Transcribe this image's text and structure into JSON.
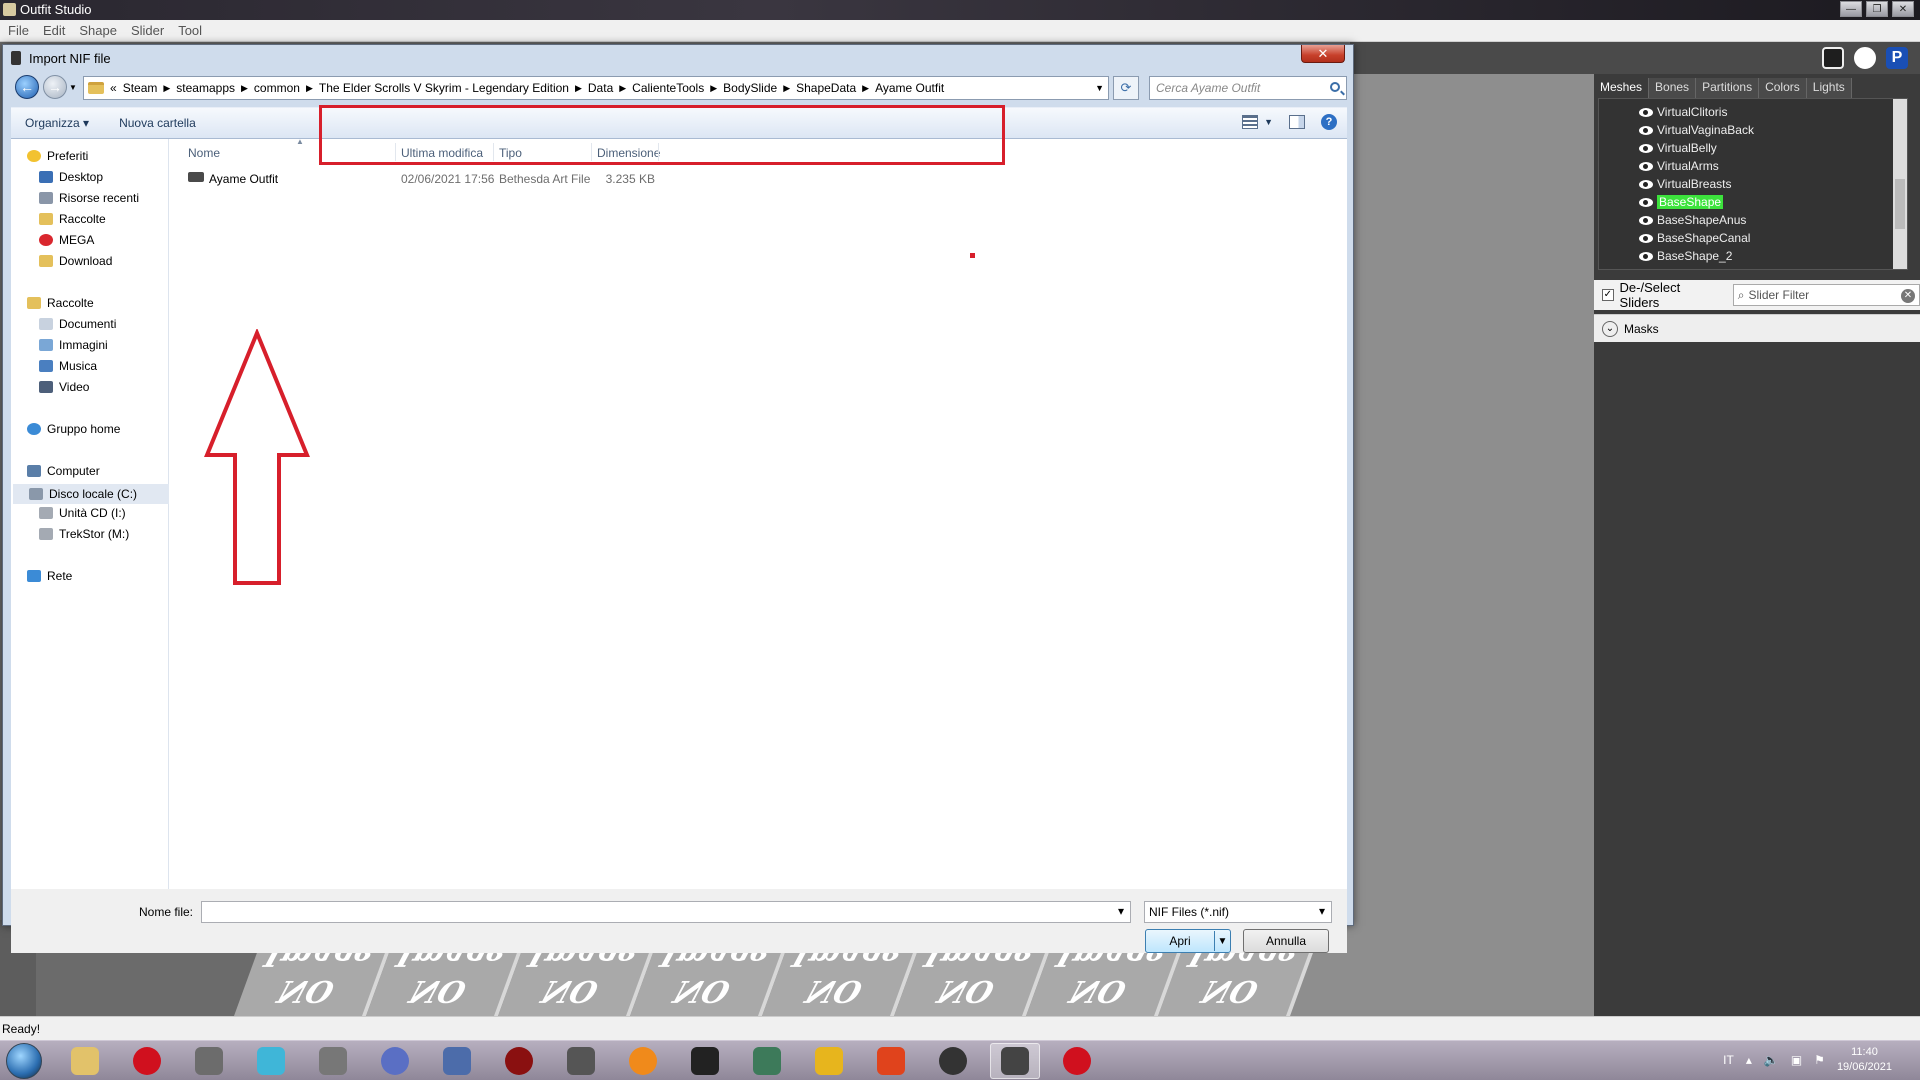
{
  "app": {
    "title": "Outfit Studio",
    "menu": [
      "File",
      "Edit",
      "Shape",
      "Slider",
      "Tool"
    ],
    "status": "Ready!"
  },
  "right_panel": {
    "tabs": [
      "Meshes",
      "Bones",
      "Partitions",
      "Colors",
      "Lights"
    ],
    "meshes": [
      "VirtualClitoris",
      "VirtualVaginaBack",
      "VirtualBelly",
      "VirtualArms",
      "VirtualBreasts",
      "BaseShape",
      "BaseShapeAnus",
      "BaseShapeCanal",
      "BaseShape_2"
    ],
    "selected_mesh": "BaseShape",
    "deselect_label": "De-/Select Sliders",
    "slider_filter_placeholder": "Slider Filter",
    "masks_label": "Masks"
  },
  "no_image": {
    "line1": "Image",
    "line2": "NO"
  },
  "dialog": {
    "title": "Import NIF file",
    "close_label": "✕",
    "breadcrumb_prefix": "«",
    "breadcrumbs": [
      "Steam",
      "steamapps",
      "common",
      "The Elder Scrolls V Skyrim - Legendary Edition",
      "Data",
      "CalienteTools",
      "BodySlide",
      "ShapeData",
      "Ayame Outfit"
    ],
    "search_placeholder": "Cerca Ayame Outfit",
    "organize_label": "Organizza ▾",
    "new_folder_label": "Nuova cartella",
    "nav_pane": [
      {
        "label": "Preferiti",
        "group": true
      },
      {
        "label": "Desktop"
      },
      {
        "label": "Risorse recenti"
      },
      {
        "label": "Raccolte"
      },
      {
        "label": "MEGA"
      },
      {
        "label": "Download"
      },
      {
        "label": "Raccolte",
        "group": true
      },
      {
        "label": "Documenti"
      },
      {
        "label": "Immagini"
      },
      {
        "label": "Musica"
      },
      {
        "label": "Video"
      },
      {
        "label": "Gruppo home",
        "group": true
      },
      {
        "label": "Computer",
        "group": true
      },
      {
        "label": "Disco locale (C:)",
        "selected": true
      },
      {
        "label": "Unità CD (I:)"
      },
      {
        "label": "TrekStor (M:)"
      },
      {
        "label": "Rete",
        "group": true
      }
    ],
    "columns": [
      "Nome",
      "Ultima modifica",
      "Tipo",
      "Dimensione"
    ],
    "files": [
      {
        "name": "Ayame Outfit",
        "modified": "02/06/2021 17:56",
        "type": "Bethesda Art File",
        "size": "3.235 KB"
      }
    ],
    "filename_label": "Nome file:",
    "filename_value": "",
    "filetype_value": "NIF Files (*.nif)",
    "open_label": "Apri",
    "cancel_label": "Annulla"
  },
  "taskbar": {
    "lang": "IT",
    "time": "11:40",
    "date": "19/06/2021"
  },
  "colors": {
    "highlight": "#d71f2b",
    "selected_mesh": "#3ce23c"
  }
}
